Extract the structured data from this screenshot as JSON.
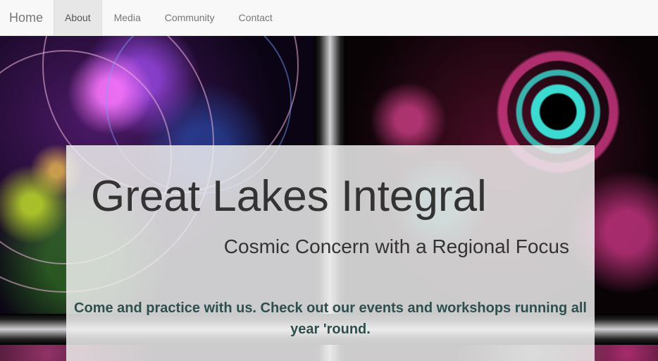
{
  "navbar": {
    "brand": "Home",
    "items": [
      {
        "label": "About",
        "active": true
      },
      {
        "label": "Media",
        "active": false
      },
      {
        "label": "Community",
        "active": false
      },
      {
        "label": "Contact",
        "active": false
      }
    ]
  },
  "hero": {
    "title": "Great Lakes Integral",
    "subtitle": "Cosmic Concern with a Regional Focus",
    "lead": "Come and practice with us. Check out our events and workshops running all year 'round."
  },
  "colors": {
    "navbar_bg": "#f8f8f8",
    "active_tab_bg": "#e7e7e7",
    "lead_text": "#2f4f4f",
    "overlay": "rgba(238,238,238,0.85)"
  }
}
